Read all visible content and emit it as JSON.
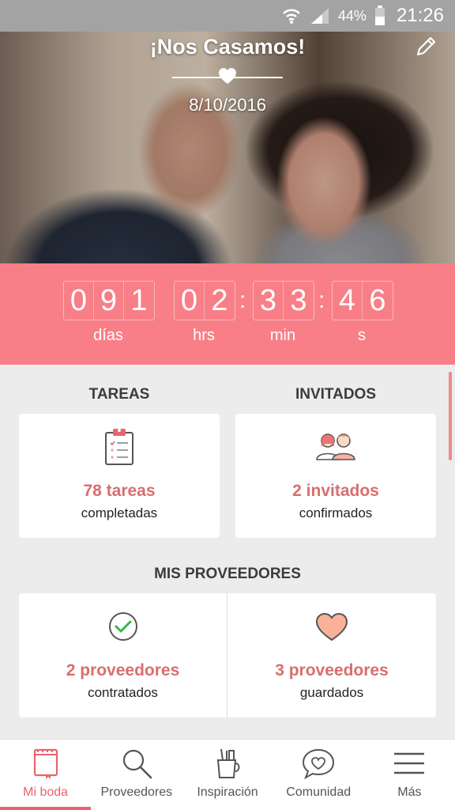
{
  "status_bar": {
    "battery_pct": "44%",
    "time": "21:26"
  },
  "hero": {
    "title": "¡Nos Casamos!",
    "date": "8/10/2016"
  },
  "countdown": {
    "days_digits": [
      "0",
      "9",
      "1"
    ],
    "hours_digits": [
      "0",
      "2"
    ],
    "minutes_digits": [
      "3",
      "3"
    ],
    "seconds_digits": [
      "4",
      "6"
    ],
    "separator": ":",
    "labels": {
      "days": "días",
      "hours": "hrs",
      "minutes": "min",
      "seconds": "s"
    }
  },
  "tareas": {
    "title": "TAREAS",
    "count": "78 tareas",
    "sub": "completadas"
  },
  "invitados": {
    "title": "INVITADOS",
    "count": "2 invitados",
    "sub": "confirmados"
  },
  "proveedores": {
    "title": "MIS PROVEEDORES",
    "hired": {
      "count": "2 proveedores",
      "sub": "contratados"
    },
    "saved": {
      "count": "3 proveedores",
      "sub": "guardados"
    }
  },
  "nav": [
    {
      "label": "Mi boda",
      "icon": "notebook-icon",
      "active": true
    },
    {
      "label": "Proveedores",
      "icon": "search-icon",
      "active": false
    },
    {
      "label": "Inspiración",
      "icon": "pencil-cup-icon",
      "active": false
    },
    {
      "label": "Comunidad",
      "icon": "chat-heart-icon",
      "active": false
    },
    {
      "label": "Más",
      "icon": "menu-icon",
      "active": false
    }
  ],
  "colors": {
    "accent": "#f87f87",
    "accent_text": "#d96e6e",
    "nav_active": "#e8646c",
    "background": "#ececec"
  }
}
